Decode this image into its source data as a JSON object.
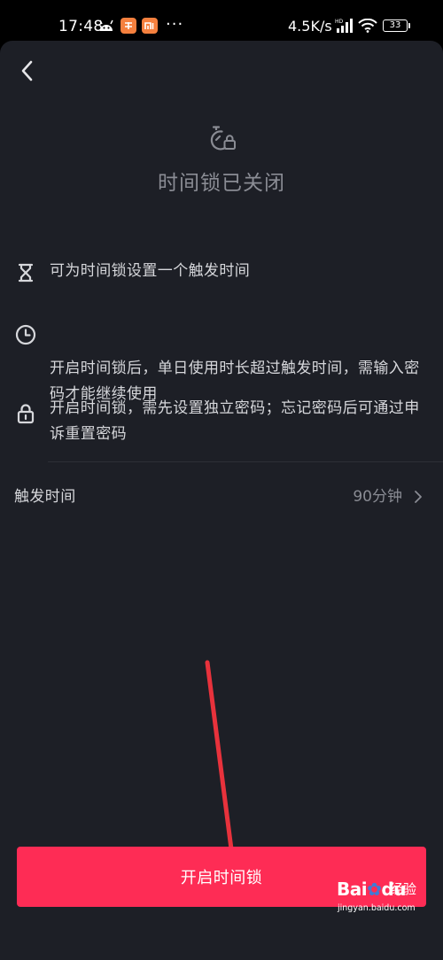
{
  "status_bar": {
    "time": "17:48",
    "dots": "···",
    "network_speed": "4.5K/s",
    "battery": "33"
  },
  "header": {
    "back_icon": "chevron-left-icon"
  },
  "hero": {
    "icon": "timer-lock-icon",
    "title": "时间锁已关闭"
  },
  "info_items": [
    {
      "icon": "hourglass-icon",
      "text": "可为时间锁设置一个触发时间"
    },
    {
      "icon": "clock-icon",
      "text": "开启时间锁后，单日使用时长超过触发时间，需输入密码才能继续使用"
    },
    {
      "icon": "lock-icon",
      "text": "开启时间锁，需先设置独立密码；忘记密码后可通过申诉重置密码"
    }
  ],
  "trigger": {
    "label": "触发时间",
    "value": "90分钟"
  },
  "cta": {
    "label": "开启时间锁"
  },
  "watermark": {
    "logo": "Baidu",
    "suffix": "经验",
    "url": "jingyan.baidu.com"
  },
  "colors": {
    "background": "#1d1f26",
    "accent": "#fe2c55",
    "annotation_arrow": "#e8323c"
  }
}
